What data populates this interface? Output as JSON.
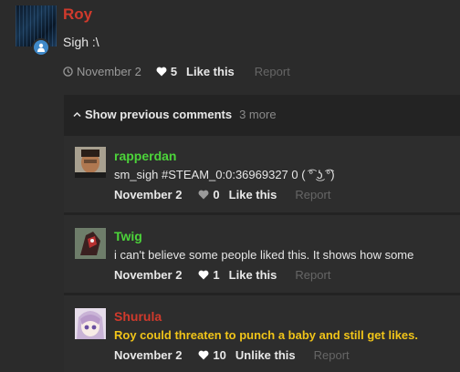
{
  "post": {
    "author": "Roy",
    "text": "Sigh :\\",
    "date": "November 2",
    "likes": "5",
    "like_label": "Like this",
    "report_label": "Report"
  },
  "comments_panel": {
    "show_previous_label": "Show previous comments",
    "previous_count": "3 more"
  },
  "comments": [
    {
      "author": "rapperdan",
      "author_color": "#4cd43a",
      "text": "sm_sigh #STEAM_0:0:36969327 0 ( ͡° ͜ʖ ͡°)",
      "date": "November 2",
      "likes": "0",
      "like_label": "Like this",
      "report_label": "Report"
    },
    {
      "author": "Twig",
      "author_color": "#4cd43a",
      "text": "i can't believe some people liked this. It shows how some",
      "date": "November 2",
      "likes": "1",
      "like_label": "Like this",
      "report_label": "Report"
    },
    {
      "author": "Shurula",
      "author_color": "#d03a2c",
      "text": "Roy could threaten to punch a baby and still get likes.",
      "text_color": "#f0c419",
      "date": "November 2",
      "likes": "10",
      "like_label": "Unlike this",
      "report_label": "Report"
    }
  ],
  "icons": {
    "clock": "clock-icon",
    "heart": "heart-icon",
    "chevron": "chevron-up-icon",
    "user": "user-icon"
  }
}
